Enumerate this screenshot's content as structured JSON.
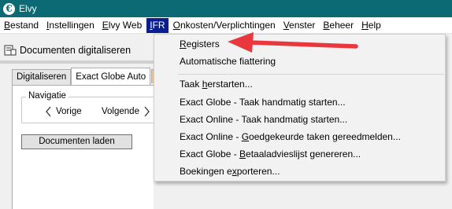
{
  "window": {
    "title": "Elvy",
    "app_icon_glyph": "€"
  },
  "menubar": {
    "items": [
      {
        "label": "Bestand",
        "ul": "B",
        "rest": "estand"
      },
      {
        "label": "Instellingen",
        "ul": "I",
        "rest": "nstellingen"
      },
      {
        "label": "Elvy Web",
        "ul": "E",
        "rest": "lvy Web"
      },
      {
        "label": "IFR",
        "ul": "I",
        "rest": "FR"
      },
      {
        "label": "Onkosten/Verplichtingen",
        "ul": "O",
        "rest": "nkosten/Verplichtingen"
      },
      {
        "label": "Venster",
        "ul": "V",
        "rest": "enster"
      },
      {
        "label": "Beheer",
        "ul": "B",
        "rest": "eheer"
      },
      {
        "label": "Help",
        "ul": "H",
        "rest": "elp"
      }
    ]
  },
  "document": {
    "title": "Documenten digitaliseren"
  },
  "tabs": [
    {
      "label": "Digitaliseren"
    },
    {
      "label": "Exact Globe Auto"
    }
  ],
  "navigation": {
    "legend": "Navigatie",
    "prev_label": "Vorige",
    "next_label": "Volgende"
  },
  "load_button": {
    "label": "Documenten laden"
  },
  "ifr_menu": {
    "items": [
      {
        "pre": "",
        "ul": "R",
        "post": "egisters"
      },
      {
        "pre": "Automatische fiattering",
        "ul": "",
        "post": ""
      },
      {
        "pre": "Taak ",
        "ul": "h",
        "post": "erstarten..."
      },
      {
        "pre": "Exact Globe - Taak handmatig starten...",
        "ul": "",
        "post": ""
      },
      {
        "pre": "Exact Online - Taak handmatig starten...",
        "ul": "",
        "post": ""
      },
      {
        "pre": "Exact Online - ",
        "ul": "G",
        "post": "oedgekeurde taken gereedmelden..."
      },
      {
        "pre": "Exact Globe - ",
        "ul": "B",
        "post": "etaaladvieslijst genereren..."
      },
      {
        "pre": "Boekingen e",
        "ul": "x",
        "post": "porteren..."
      }
    ]
  },
  "colors": {
    "titlebar": "#0b6a73",
    "menu_active": "#0a1f8f",
    "arrow": "#e8383d",
    "dropdown_bg": "#f2f2f2"
  }
}
